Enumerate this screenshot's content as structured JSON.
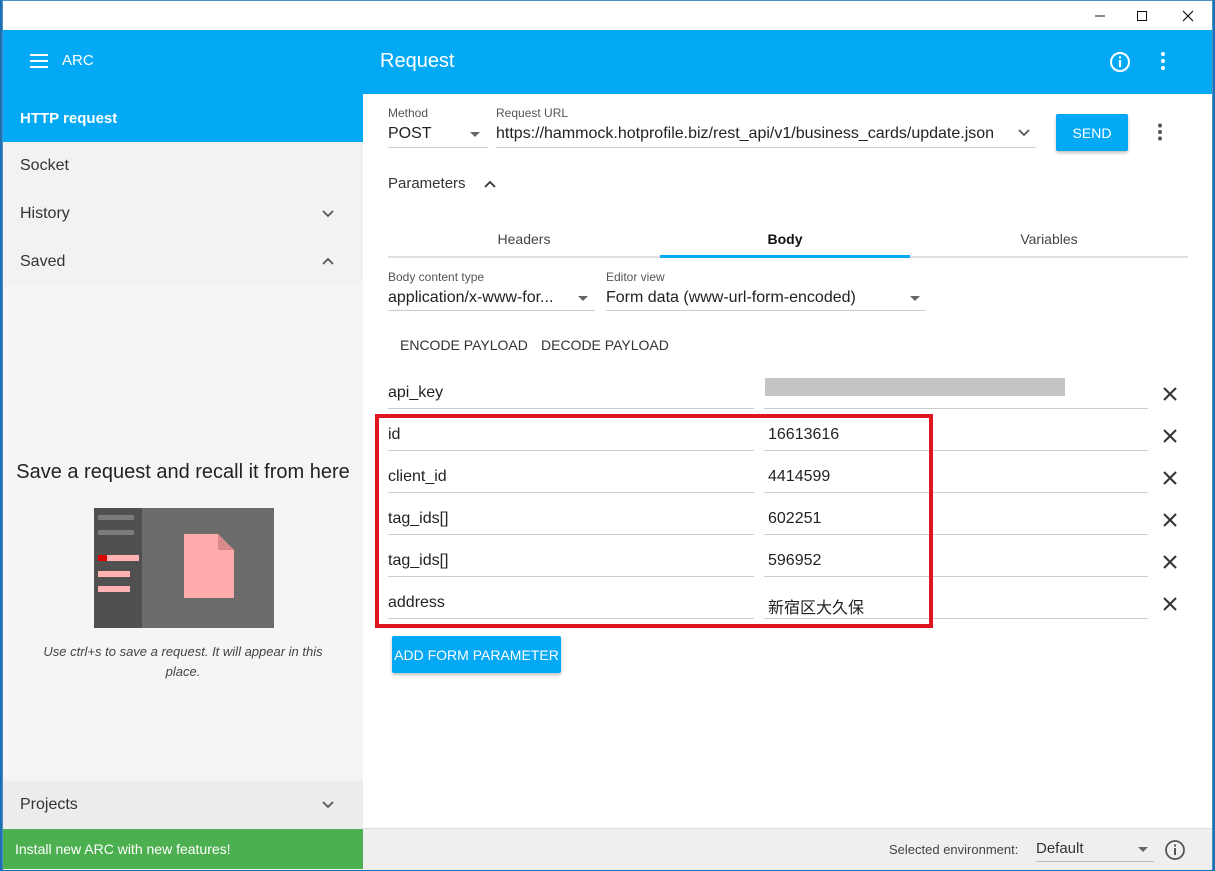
{
  "window": {
    "controls": [
      "minimize",
      "maximize",
      "close"
    ]
  },
  "appbar": {
    "brand": "ARC",
    "title": "Request"
  },
  "sidebar": {
    "items": [
      {
        "label": "HTTP request"
      },
      {
        "label": "Socket"
      },
      {
        "label": "History"
      },
      {
        "label": "Saved"
      }
    ],
    "saved_title": "Save a request and recall it from here",
    "saved_hint": "Use ctrl+s to save a request. It will appear in this place.",
    "projects_label": "Projects",
    "install_banner": "Install new ARC with new features!"
  },
  "request": {
    "method_label": "Method",
    "method_value": "POST",
    "url_label": "Request URL",
    "url_value": "https://hammock.hotprofile.biz/rest_api/v1/business_cards/update.json",
    "send_label": "SEND",
    "parameters_label": "Parameters",
    "tabs": [
      {
        "label": "Headers"
      },
      {
        "label": "Body"
      },
      {
        "label": "Variables"
      }
    ],
    "body_type_label": "Body content type",
    "body_type_value": "application/x-www-for...",
    "editor_view_label": "Editor view",
    "editor_view_value": "Form data (www-url-form-encoded)",
    "encode_label": "ENCODE PAYLOAD",
    "decode_label": "DECODE PAYLOAD",
    "params": [
      {
        "name": "api_key",
        "value": ""
      },
      {
        "name": "id",
        "value": "16613616"
      },
      {
        "name": "client_id",
        "value": "4414599"
      },
      {
        "name": "tag_ids[]",
        "value": "602251"
      },
      {
        "name": "tag_ids[]",
        "value": "596952"
      },
      {
        "name": "address",
        "value": "新宿区大久保"
      }
    ],
    "add_param_label": "ADD FORM PARAMETER"
  },
  "footer": {
    "env_label": "Selected environment:",
    "env_value": "Default"
  },
  "colors": {
    "accent": "#03a9f4",
    "install_green": "#4caf50",
    "highlight_red": "#e0141e"
  }
}
